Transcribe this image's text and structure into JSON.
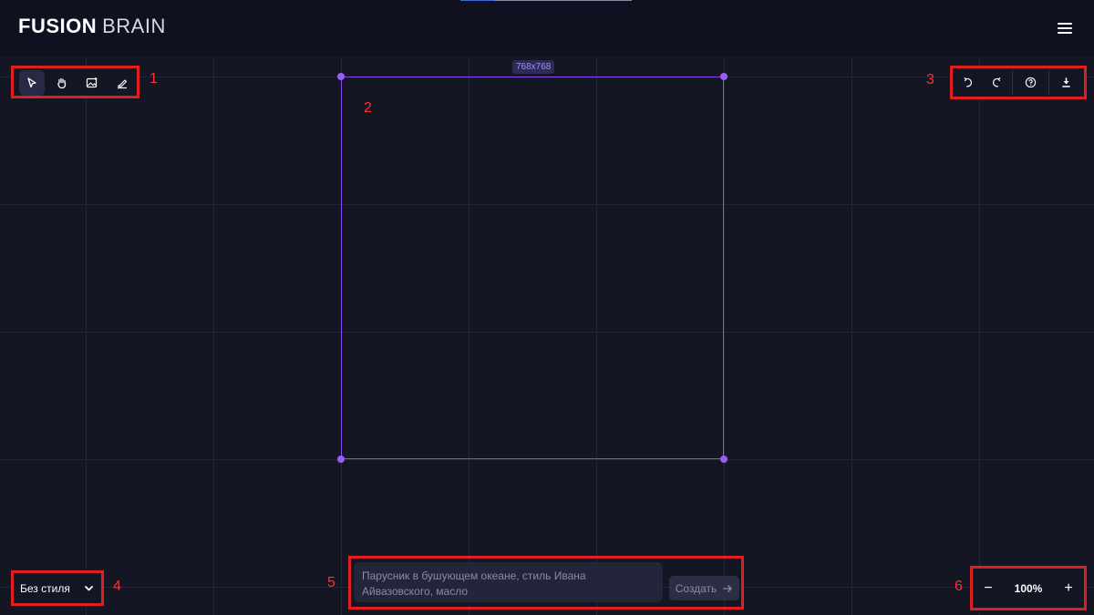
{
  "header": {
    "logo_bold": "FUSION",
    "logo_light": "BRAIN",
    "menu_icon": "hamburger-icon"
  },
  "tools": [
    {
      "name": "select",
      "icon": "cursor-arrow-icon",
      "active": true
    },
    {
      "name": "hand",
      "icon": "hand-pan-icon",
      "active": false
    },
    {
      "name": "image",
      "icon": "image-add-icon",
      "active": false
    },
    {
      "name": "eraser",
      "icon": "eraser-icon",
      "active": false
    }
  ],
  "canvas": {
    "size_label": "768x768",
    "accent_color": "#9b5cf6"
  },
  "actions": [
    {
      "name": "undo",
      "icon": "undo-icon"
    },
    {
      "name": "redo",
      "icon": "redo-icon"
    },
    {
      "name": "help",
      "icon": "help-circle-icon"
    },
    {
      "name": "download",
      "icon": "download-icon"
    }
  ],
  "style_select": {
    "value": "Без стиля",
    "icon": "chevron-down-icon"
  },
  "prompt": {
    "placeholder": "Парусник в бушующем океане, стиль Ивана Айвазовского, масло",
    "create_label": "Создать",
    "create_icon": "arrow-right-icon"
  },
  "zoom": {
    "minus": "−",
    "value": "100%",
    "plus": "+"
  },
  "callouts": [
    "1",
    "2",
    "3",
    "4",
    "5",
    "6"
  ],
  "colors": {
    "background": "#141623",
    "header": "#0f1120",
    "annotation": "#e02020"
  }
}
